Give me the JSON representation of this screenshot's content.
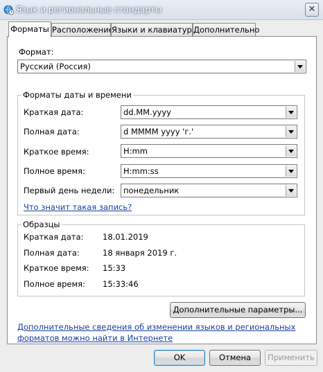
{
  "window": {
    "title": "Язык и региональные стандарты",
    "close_glyph": "✕"
  },
  "tabs": [
    {
      "label": "Форматы",
      "active": true
    },
    {
      "label": "Расположение"
    },
    {
      "label": "Языки и клавиатуры"
    },
    {
      "label": "Дополнительно"
    }
  ],
  "format": {
    "label": "Формат:",
    "value": "Русский (Россия)"
  },
  "datetime": {
    "caption": "Форматы даты и времени",
    "rows": [
      {
        "label": "Краткая дата:",
        "value": "dd.MM.yyyy"
      },
      {
        "label": "Полная дата:",
        "value": "d MMMM yyyy 'г.'"
      },
      {
        "label": "Краткое время:",
        "value": "H:mm"
      },
      {
        "label": "Полное время:",
        "value": "H:mm:ss"
      },
      {
        "label": "Первый день недели:",
        "value": "понедельник"
      }
    ],
    "help_link": "Что значит такая запись?"
  },
  "samples": {
    "caption": "Образцы",
    "rows": [
      {
        "label": "Краткая дата:",
        "value": "18.01.2019"
      },
      {
        "label": "Полная дата:",
        "value": "18 января 2019 г."
      },
      {
        "label": "Краткое время:",
        "value": "15:33"
      },
      {
        "label": "Полное время:",
        "value": "15:33:46"
      }
    ]
  },
  "additional_settings_button": "Дополнительные параметры...",
  "info_link": {
    "line1": "Дополнительные сведения об изменении языков и региональных",
    "line2": "форматов можно найти в Интернете"
  },
  "buttons": {
    "ok": "OK",
    "cancel": "Отмена",
    "apply": "Применить"
  },
  "colors": {
    "link": "#1a3e9c",
    "title_bar": "#d8e1ec"
  }
}
